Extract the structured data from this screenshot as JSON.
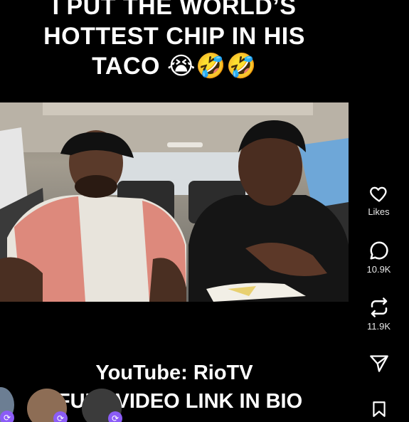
{
  "caption_top": {
    "line1": "I PUT THE WORLD’S",
    "line2": "HOTTEST CHIP IN HIS",
    "line3": "TACO 😭🤣🤣"
  },
  "caption_bottom": {
    "line1": "YouTube: RioTV",
    "line2": "FULL VIDEO LINK IN BIO"
  },
  "actions": {
    "like": {
      "label": "Likes",
      "icon": "heart-icon"
    },
    "comment": {
      "label": "10.9K",
      "icon": "comment-icon"
    },
    "repost": {
      "label": "11.9K",
      "icon": "repost-icon"
    },
    "share": {
      "icon": "send-icon"
    },
    "save": {
      "icon": "bookmark-icon"
    }
  },
  "colors": {
    "background": "#000000",
    "badge": "#8b5cf6",
    "label": "#e6e6e6"
  }
}
